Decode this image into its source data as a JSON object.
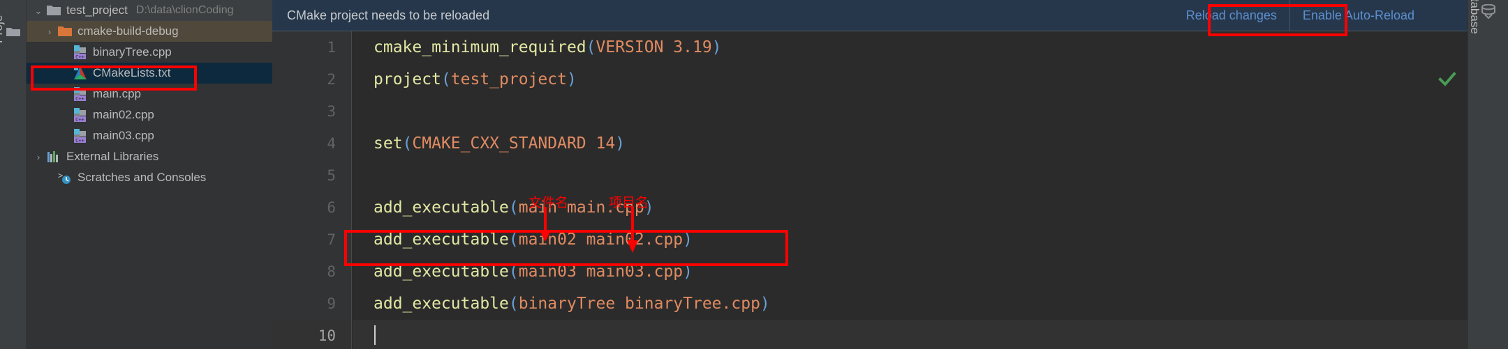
{
  "left_strip": {
    "tool_label": "Proje",
    "folder_icon": "folder-icon"
  },
  "right_strip": {
    "tool_label": "Database",
    "db_icon": "database-icon"
  },
  "project_tree": {
    "items": [
      {
        "label": "test_project",
        "path": "D:\\data\\clionCoding",
        "icon": "folder-grey-icon",
        "arrow": "⌄",
        "indent": 0,
        "state": "root"
      },
      {
        "label": "cmake-build-debug",
        "path": "",
        "icon": "folder-orange-icon",
        "arrow": "›",
        "indent": 1,
        "state": "folder-sel"
      },
      {
        "label": "binaryTree.cpp",
        "path": "",
        "icon": "cpp-file-icon",
        "arrow": "",
        "indent": 2,
        "state": ""
      },
      {
        "label": "CMakeLists.txt",
        "path": "",
        "icon": "cmake-file-icon",
        "arrow": "",
        "indent": 2,
        "state": "file-sel"
      },
      {
        "label": "main.cpp",
        "path": "",
        "icon": "cpp-file-icon",
        "arrow": "",
        "indent": 2,
        "state": ""
      },
      {
        "label": "main02.cpp",
        "path": "",
        "icon": "cpp-file-icon",
        "arrow": "",
        "indent": 2,
        "state": ""
      },
      {
        "label": "main03.cpp",
        "path": "",
        "icon": "cpp-file-icon",
        "arrow": "",
        "indent": 2,
        "state": ""
      },
      {
        "label": "External Libraries",
        "path": "",
        "icon": "libraries-icon",
        "arrow": "›",
        "indent": 0,
        "state": ""
      },
      {
        "label": "Scratches and Consoles",
        "path": "",
        "icon": "scratches-icon",
        "arrow": "",
        "indent": 1,
        "state": ""
      }
    ]
  },
  "notification": {
    "message": "CMake project needs to be reloaded",
    "reload_label": "Reload changes",
    "auto_reload_label": "Enable Auto-Reload"
  },
  "editor": {
    "ok_icon": "green-check-icon",
    "line_numbers": [
      "1",
      "2",
      "3",
      "4",
      "5",
      "6",
      "7",
      "8",
      "9",
      "10"
    ],
    "lines": [
      {
        "n": "1",
        "current": false,
        "tokens": [
          {
            "t": "cmake_minimum_required",
            "c": "kw"
          },
          {
            "t": "(",
            "c": "par"
          },
          {
            "t": "VERSION 3.19",
            "c": "arg"
          },
          {
            "t": ")",
            "c": "par"
          }
        ]
      },
      {
        "n": "2",
        "current": false,
        "tokens": [
          {
            "t": "project",
            "c": "kw"
          },
          {
            "t": "(",
            "c": "par"
          },
          {
            "t": "test_project",
            "c": "arg"
          },
          {
            "t": ")",
            "c": "par"
          }
        ]
      },
      {
        "n": "3",
        "current": false,
        "tokens": []
      },
      {
        "n": "4",
        "current": false,
        "tokens": [
          {
            "t": "set",
            "c": "kw"
          },
          {
            "t": "(",
            "c": "par"
          },
          {
            "t": "CMAKE_CXX_STANDARD 14",
            "c": "arg"
          },
          {
            "t": ")",
            "c": "par"
          }
        ]
      },
      {
        "n": "5",
        "current": false,
        "tokens": []
      },
      {
        "n": "6",
        "current": false,
        "tokens": [
          {
            "t": "add_executable",
            "c": "kw"
          },
          {
            "t": "(",
            "c": "par"
          },
          {
            "t": "main main.cpp",
            "c": "arg"
          },
          {
            "t": ")",
            "c": "par"
          }
        ]
      },
      {
        "n": "7",
        "current": false,
        "tokens": [
          {
            "t": "add_executable",
            "c": "kw"
          },
          {
            "t": "(",
            "c": "par"
          },
          {
            "t": "main02 main02.cpp",
            "c": "arg"
          },
          {
            "t": ")",
            "c": "par"
          }
        ]
      },
      {
        "n": "8",
        "current": false,
        "tokens": [
          {
            "t": "add_executable",
            "c": "kw"
          },
          {
            "t": "(",
            "c": "par"
          },
          {
            "t": "main03 main03.cpp",
            "c": "arg"
          },
          {
            "t": ")",
            "c": "par"
          }
        ]
      },
      {
        "n": "9",
        "current": false,
        "tokens": [
          {
            "t": "add_executable",
            "c": "kw"
          },
          {
            "t": "(",
            "c": "par"
          },
          {
            "t": "binaryTree binaryTree.cpp",
            "c": "arg"
          },
          {
            "t": ")",
            "c": "par"
          }
        ]
      },
      {
        "n": "10",
        "current": true,
        "tokens": []
      }
    ]
  },
  "annotations": {
    "filename_label": "文件名",
    "project_label": "项目名",
    "highlight_color": "#ff0000"
  }
}
